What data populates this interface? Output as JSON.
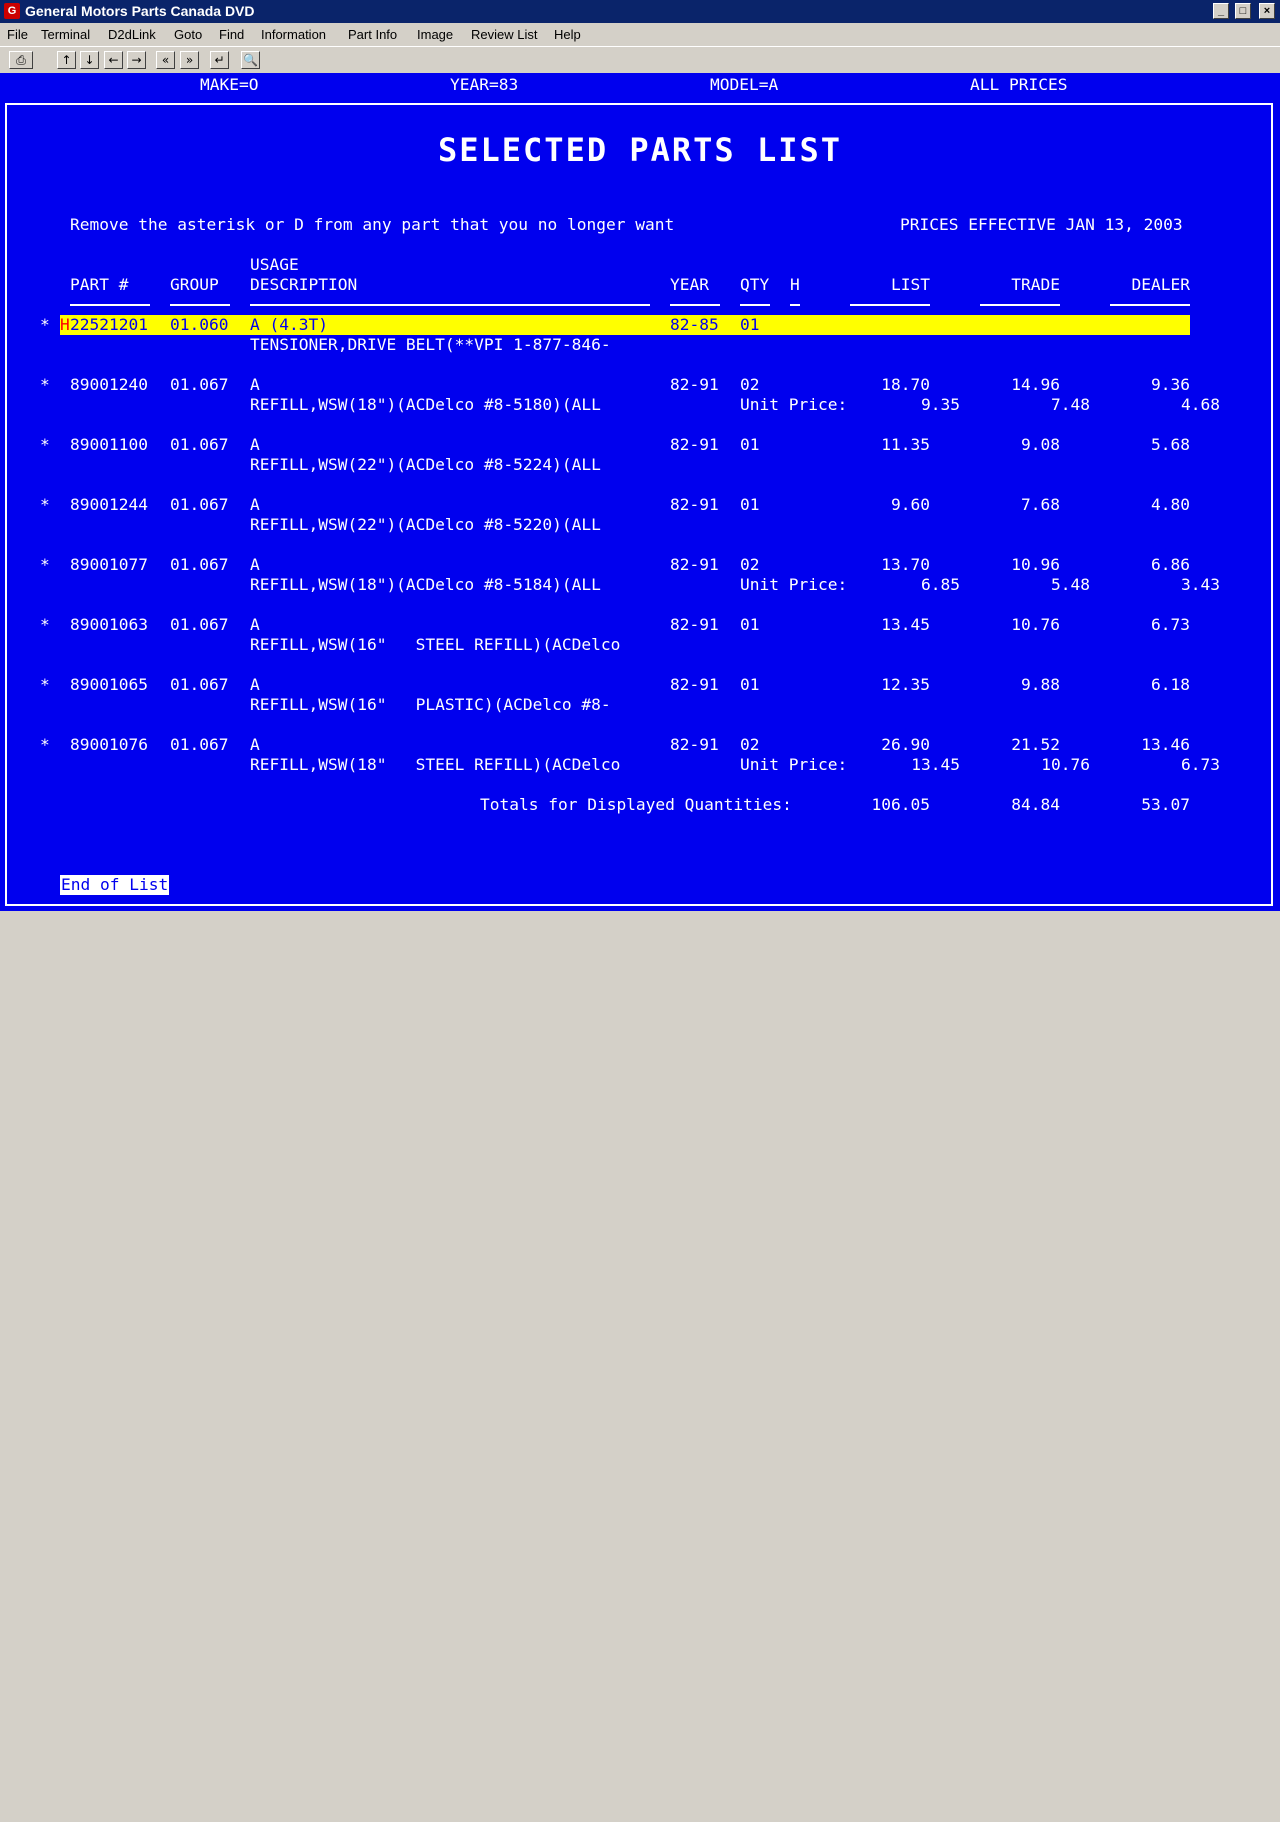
{
  "window": {
    "title": "General Motors Parts Canada DVD",
    "icon": "gm-app-icon",
    "controls": [
      "_",
      "□",
      "×"
    ]
  },
  "menu": [
    "File",
    "Terminal",
    "D2dLink",
    "Goto",
    "Find",
    "Information",
    "Part Info",
    "Image",
    "Review List",
    "Help"
  ],
  "toolbar": {
    "print": "⎙",
    "up": "↑",
    "down": "↓",
    "left": "←",
    "right": "→",
    "prev": "«",
    "next": "»",
    "enter": "↵",
    "zoom": "🔍"
  },
  "status": {
    "make": "MAKE=O",
    "year": "YEAR=83",
    "model": "MODEL=A",
    "prices": "ALL PRICES"
  },
  "screen": {
    "title": "SELECTED PARTS LIST",
    "instruction": "Remove the asterisk or D from any part that you no longer want",
    "effective": "PRICES EFFECTIVE JAN 13, 2003",
    "headers": {
      "part": "PART #",
      "group": "GROUP",
      "usage": "USAGE",
      "description": "DESCRIPTION",
      "year": "YEAR",
      "qty": "QTY",
      "h": "H",
      "list": "LIST",
      "trade": "TRADE",
      "dealer": "DEALER"
    },
    "rows": [
      {
        "mark": "*",
        "flag": "H",
        "part": "22521201",
        "group": "01.060",
        "usage": "A (4.3T)",
        "year": "82-85",
        "qty": "01",
        "desc": "TENSIONER,DRIVE BELT(**VPI 1-877-846-",
        "list": "",
        "trade": "",
        "dealer": "",
        "unit_label": "",
        "unit_list": "",
        "unit_trade": "",
        "unit_dealer": ""
      },
      {
        "mark": "*",
        "flag": "",
        "part": "89001240",
        "group": "01.067",
        "usage": "A",
        "year": "82-91",
        "qty": "02",
        "desc": "REFILL,WSW(18\")(ACDelco #8-5180)(ALL",
        "list": "18.70",
        "trade": "14.96",
        "dealer": "9.36",
        "unit_label": "Unit Price:",
        "unit_list": "9.35",
        "unit_trade": "7.48",
        "unit_dealer": "4.68"
      },
      {
        "mark": "*",
        "flag": "",
        "part": "89001100",
        "group": "01.067",
        "usage": "A",
        "year": "82-91",
        "qty": "01",
        "desc": "REFILL,WSW(22\")(ACDelco #8-5224)(ALL",
        "list": "11.35",
        "trade": "9.08",
        "dealer": "5.68",
        "unit_label": "",
        "unit_list": "",
        "unit_trade": "",
        "unit_dealer": ""
      },
      {
        "mark": "*",
        "flag": "",
        "part": "89001244",
        "group": "01.067",
        "usage": "A",
        "year": "82-91",
        "qty": "01",
        "desc": "REFILL,WSW(22\")(ACDelco #8-5220)(ALL",
        "list": "9.60",
        "trade": "7.68",
        "dealer": "4.80",
        "unit_label": "",
        "unit_list": "",
        "unit_trade": "",
        "unit_dealer": ""
      },
      {
        "mark": "*",
        "flag": "",
        "part": "89001077",
        "group": "01.067",
        "usage": "A",
        "year": "82-91",
        "qty": "02",
        "desc": "REFILL,WSW(18\")(ACDelco #8-5184)(ALL",
        "list": "13.70",
        "trade": "10.96",
        "dealer": "6.86",
        "unit_label": "Unit Price:",
        "unit_list": "6.85",
        "unit_trade": "5.48",
        "unit_dealer": "3.43"
      },
      {
        "mark": "*",
        "flag": "",
        "part": "89001063",
        "group": "01.067",
        "usage": "A",
        "year": "82-91",
        "qty": "01",
        "desc": "REFILL,WSW(16\"   STEEL REFILL)(ACDelco",
        "list": "13.45",
        "trade": "10.76",
        "dealer": "6.73",
        "unit_label": "",
        "unit_list": "",
        "unit_trade": "",
        "unit_dealer": ""
      },
      {
        "mark": "*",
        "flag": "",
        "part": "89001065",
        "group": "01.067",
        "usage": "A",
        "year": "82-91",
        "qty": "01",
        "desc": "REFILL,WSW(16\"   PLASTIC)(ACDelco #8-",
        "list": "12.35",
        "trade": "9.88",
        "dealer": "6.18",
        "unit_label": "",
        "unit_list": "",
        "unit_trade": "",
        "unit_dealer": ""
      },
      {
        "mark": "*",
        "flag": "",
        "part": "89001076",
        "group": "01.067",
        "usage": "A",
        "year": "82-91",
        "qty": "02",
        "desc": "REFILL,WSW(18\"   STEEL REFILL)(ACDelco",
        "list": "26.90",
        "trade": "21.52",
        "dealer": "13.46",
        "unit_label": "Unit Price:",
        "unit_list": "13.45",
        "unit_trade": "10.76",
        "unit_dealer": "6.73"
      }
    ],
    "totals": {
      "label": "Totals for Displayed Quantities:",
      "list": "106.05",
      "trade": "84.84",
      "dealer": "53.07"
    },
    "end_of_list": "End of List"
  },
  "colors": {
    "screen_bg": "#0000ee",
    "highlight": "#ffff00",
    "flag": "#ff0000",
    "titlebar": "#0a246a"
  }
}
